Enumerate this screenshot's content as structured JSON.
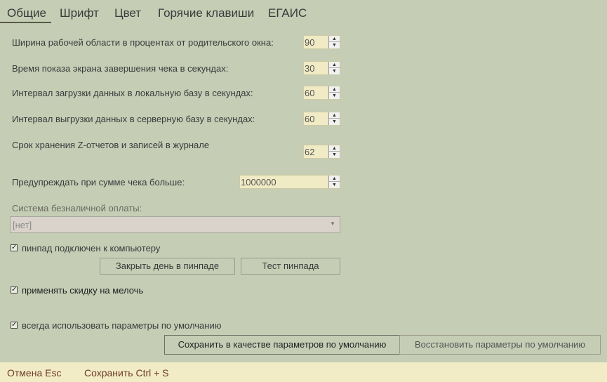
{
  "tabs": [
    {
      "label": "Общие"
    },
    {
      "label": "Шрифт"
    },
    {
      "label": "Цвет"
    },
    {
      "label": "Горячие клавиши"
    },
    {
      "label": "ЕГАИС"
    }
  ],
  "settings": {
    "work_area_label": "Ширина рабочей области в процентах от родительского окна:",
    "work_area_value": "90",
    "receipt_screen_label": "Время показа экрана завершения чека в секундах:",
    "receipt_screen_value": "30",
    "download_interval_label": "Интервал загрузки данных в локальную базу в секундах:",
    "download_interval_value": "60",
    "upload_interval_label": "Интервал выгрузки данных в серверную базу в секундах:",
    "upload_interval_value": "60",
    "z_reports_label": "Срок хранения Z-отчетов и записей в журнале",
    "z_reports_value": "62",
    "warn_sum_label": "Предупреждать при сумме чека больше:",
    "warn_sum_value": "1000000",
    "cashless_label": "Система безналичной оплаты:",
    "cashless_value": "[нет]",
    "pinpad_label": "пинпад подключен к компьютеру",
    "close_day_button": "Закрыть день в пинпаде",
    "test_pinpad_button": "Тест пинпада",
    "discount_label": "применять скидку на мелочь",
    "defaults_label": "всегда использовать параметры по умолчанию",
    "save_defaults_button": "Сохранить в качестве параметров по умолчанию",
    "restore_defaults_button": "Восстановить параметры по умолчанию"
  },
  "footer": {
    "cancel": "Отмена Esc",
    "save": "Сохранить Ctrl + S"
  },
  "colors": {
    "background": "#c5cdb5",
    "input": "#f0ebc4",
    "footer": "#f2ecc6",
    "footer_link": "#6d3b28"
  }
}
